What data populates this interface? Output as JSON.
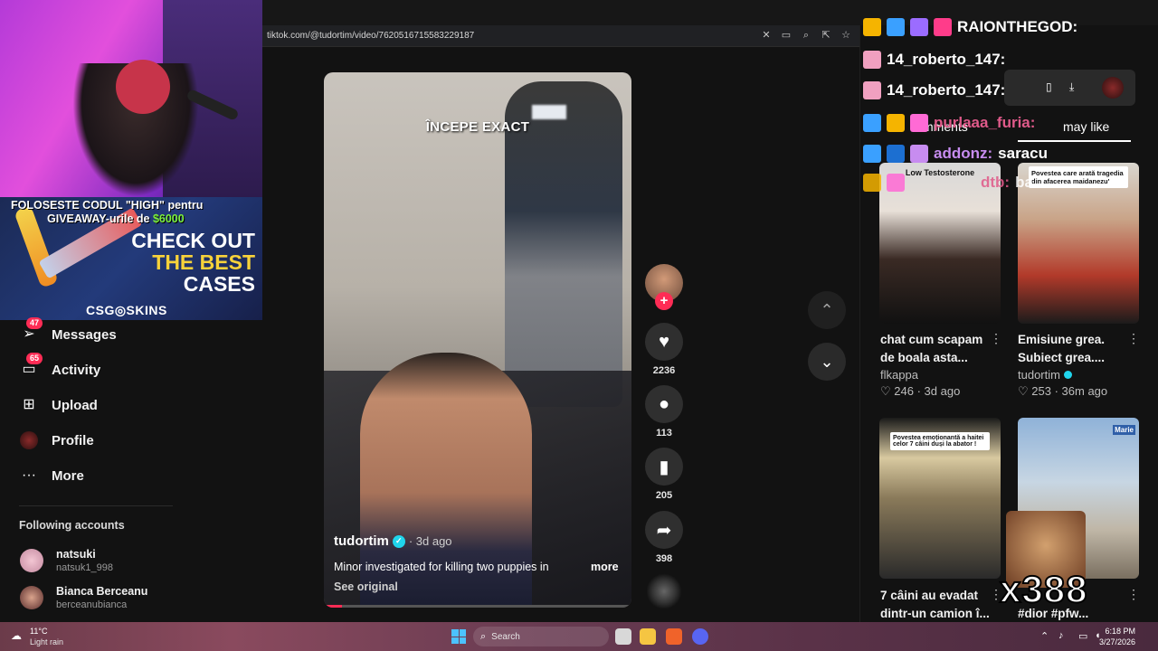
{
  "browser": {
    "url": "tiktok.com/@tudortim/video/7620516715583229187"
  },
  "overlay_ad": {
    "line1": "FOLOSESTE CODUL \"HIGH\" pentru",
    "line2_prefix": "GIVEAWAY-urile de ",
    "line2_amount": "$6000",
    "check_line1": "CHECK OUT",
    "check_line2": "THE BEST",
    "check_line3": "CASES",
    "brand": "CSG◎SKINS"
  },
  "sidebar": {
    "items": [
      {
        "label": "Messages",
        "badge": "47",
        "icon": "send-icon"
      },
      {
        "label": "Activity",
        "badge": "65",
        "icon": "message-icon"
      },
      {
        "label": "Upload",
        "badge": "",
        "icon": "plus-square-icon"
      },
      {
        "label": "Profile",
        "badge": "",
        "icon": "avatar-icon"
      },
      {
        "label": "More",
        "badge": "",
        "icon": "ellipsis-icon"
      }
    ],
    "following_title": "Following accounts",
    "accounts": [
      {
        "name": "natsuki",
        "handle": "natsuk1_998"
      },
      {
        "name": "Bianca Berceanu",
        "handle": "berceanubianca"
      }
    ]
  },
  "video": {
    "overlay_text": "ÎNCEPE EXACT",
    "author": "tudortim",
    "age": "· 3d ago",
    "caption": "Minor investigated for killing two puppies in",
    "more": "more",
    "see_original": "See original",
    "progress": 0.06
  },
  "actions": {
    "likes": "2236",
    "comments": "113",
    "saves": "205",
    "shares": "398"
  },
  "right_panel": {
    "tab_comments": "mments",
    "tab_you_may_like": "may like",
    "recommendations": [
      {
        "title": "chat cum scapam de boala asta...",
        "author": "flkappa",
        "likes": "246",
        "age": "3d ago",
        "thumb_text": "Low Testosterone"
      },
      {
        "title": "Emisiune grea. Subiect grea....",
        "author": "tudortim",
        "likes": "253",
        "age": "36m ago",
        "thumb_text": "Povestea care arată tragedia din afacerea maidanezu'"
      },
      {
        "title": "7 câini au evadat dintr-un camion î...",
        "author": "",
        "likes": "",
        "age": "",
        "thumb_text": "Povestea emoționantă a haitei celor 7 câini duși la abator !"
      },
      {
        "title": "#dior #pfw...",
        "author": "",
        "likes": "",
        "age": "",
        "thumb_text": "Marie"
      }
    ]
  },
  "chat": [
    {
      "user": "RAIONTHEGOD:",
      "msg": "",
      "color": "#ffffff"
    },
    {
      "user": "14_roberto_147:",
      "msg": "",
      "color": "#ffffff"
    },
    {
      "user": "14_roberto_147:",
      "msg": "",
      "color": "#ffffff"
    },
    {
      "user": "purlaaa_furia:",
      "msg": "",
      "color": "#e05a8a"
    },
    {
      "user": "addonz:",
      "msg": "saracu",
      "color": "#c78cf0"
    },
    {
      "user": "dtb:",
      "msg": "ba",
      "color": "#e05a8a"
    }
  ],
  "emote_counter": "x388",
  "taskbar": {
    "weather_temp": "11°C",
    "weather_desc": "Light rain",
    "search_label": "Search",
    "time": "6:18 PM",
    "date": "3/27/2026"
  },
  "colors": {
    "accent": "#fe2c55",
    "verified": "#20d5ec",
    "background": "#121212"
  }
}
